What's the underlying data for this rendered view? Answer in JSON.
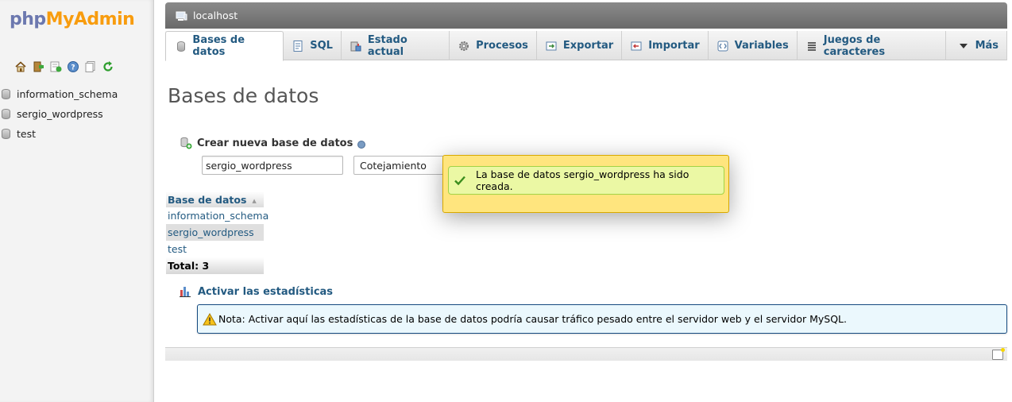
{
  "logo": {
    "php": "php",
    "my": "My",
    "admin": "Admin"
  },
  "sidebar": {
    "icons": [
      "home-icon",
      "exit-icon",
      "sql-query-icon",
      "help-icon",
      "docs-icon",
      "reload-icon"
    ],
    "databases": [
      {
        "label": "information_schema"
      },
      {
        "label": "sergio_wordpress"
      },
      {
        "label": "test"
      }
    ]
  },
  "server": {
    "label": "localhost"
  },
  "tabs": [
    {
      "label": "Bases de datos",
      "icon": "database-icon",
      "active": true
    },
    {
      "label": "SQL",
      "icon": "sql-icon"
    },
    {
      "label": "Estado actual",
      "icon": "status-icon"
    },
    {
      "label": "Procesos",
      "icon": "gear-icon"
    },
    {
      "label": "Exportar",
      "icon": "export-icon"
    },
    {
      "label": "Importar",
      "icon": "import-icon"
    },
    {
      "label": "Variables",
      "icon": "variables-icon"
    },
    {
      "label": "Juegos de caracteres",
      "icon": "charset-icon"
    },
    {
      "label": "Más",
      "icon": "caret-down-icon"
    }
  ],
  "main": {
    "title": "Bases de datos",
    "create": {
      "title": "Crear nueva base de datos",
      "input_value": "sergio_wordpress",
      "collation_value": "Cotejamiento"
    },
    "table": {
      "header": "Base de datos",
      "rows": [
        "information_schema",
        "sergio_wordpress",
        "test"
      ],
      "total": "Total: 3"
    },
    "stats_link": "Activar las estadísticas",
    "note": "Nota: Activar aquí las estadísticas de la base de datos podría causar tráfico pesado entre el servidor web y el servidor MySQL."
  },
  "popup": {
    "message": "La base de datos sergio_wordpress ha sido creada."
  },
  "colors": {
    "link": "#235a81",
    "accent_orange": "#f89c0e",
    "popup_bg": "#ffe57e",
    "success_bg": "#ebf8a4",
    "note_bg": "#ebf8fd"
  }
}
